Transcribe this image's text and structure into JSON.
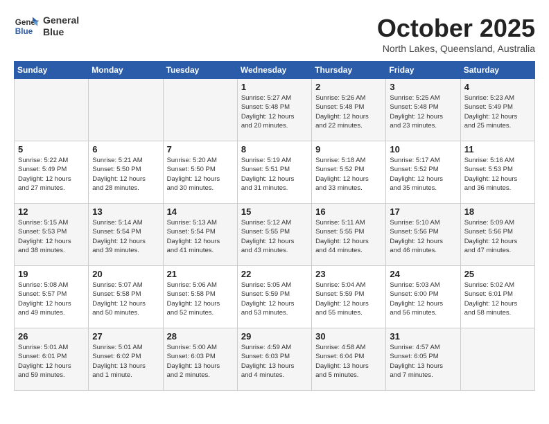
{
  "header": {
    "logo_line1": "General",
    "logo_line2": "Blue",
    "month_year": "October 2025",
    "location": "North Lakes, Queensland, Australia"
  },
  "weekdays": [
    "Sunday",
    "Monday",
    "Tuesday",
    "Wednesday",
    "Thursday",
    "Friday",
    "Saturday"
  ],
  "weeks": [
    [
      {
        "day": "",
        "info": ""
      },
      {
        "day": "",
        "info": ""
      },
      {
        "day": "",
        "info": ""
      },
      {
        "day": "1",
        "info": "Sunrise: 5:27 AM\nSunset: 5:48 PM\nDaylight: 12 hours\nand 20 minutes."
      },
      {
        "day": "2",
        "info": "Sunrise: 5:26 AM\nSunset: 5:48 PM\nDaylight: 12 hours\nand 22 minutes."
      },
      {
        "day": "3",
        "info": "Sunrise: 5:25 AM\nSunset: 5:48 PM\nDaylight: 12 hours\nand 23 minutes."
      },
      {
        "day": "4",
        "info": "Sunrise: 5:23 AM\nSunset: 5:49 PM\nDaylight: 12 hours\nand 25 minutes."
      }
    ],
    [
      {
        "day": "5",
        "info": "Sunrise: 5:22 AM\nSunset: 5:49 PM\nDaylight: 12 hours\nand 27 minutes."
      },
      {
        "day": "6",
        "info": "Sunrise: 5:21 AM\nSunset: 5:50 PM\nDaylight: 12 hours\nand 28 minutes."
      },
      {
        "day": "7",
        "info": "Sunrise: 5:20 AM\nSunset: 5:50 PM\nDaylight: 12 hours\nand 30 minutes."
      },
      {
        "day": "8",
        "info": "Sunrise: 5:19 AM\nSunset: 5:51 PM\nDaylight: 12 hours\nand 31 minutes."
      },
      {
        "day": "9",
        "info": "Sunrise: 5:18 AM\nSunset: 5:52 PM\nDaylight: 12 hours\nand 33 minutes."
      },
      {
        "day": "10",
        "info": "Sunrise: 5:17 AM\nSunset: 5:52 PM\nDaylight: 12 hours\nand 35 minutes."
      },
      {
        "day": "11",
        "info": "Sunrise: 5:16 AM\nSunset: 5:53 PM\nDaylight: 12 hours\nand 36 minutes."
      }
    ],
    [
      {
        "day": "12",
        "info": "Sunrise: 5:15 AM\nSunset: 5:53 PM\nDaylight: 12 hours\nand 38 minutes."
      },
      {
        "day": "13",
        "info": "Sunrise: 5:14 AM\nSunset: 5:54 PM\nDaylight: 12 hours\nand 39 minutes."
      },
      {
        "day": "14",
        "info": "Sunrise: 5:13 AM\nSunset: 5:54 PM\nDaylight: 12 hours\nand 41 minutes."
      },
      {
        "day": "15",
        "info": "Sunrise: 5:12 AM\nSunset: 5:55 PM\nDaylight: 12 hours\nand 43 minutes."
      },
      {
        "day": "16",
        "info": "Sunrise: 5:11 AM\nSunset: 5:55 PM\nDaylight: 12 hours\nand 44 minutes."
      },
      {
        "day": "17",
        "info": "Sunrise: 5:10 AM\nSunset: 5:56 PM\nDaylight: 12 hours\nand 46 minutes."
      },
      {
        "day": "18",
        "info": "Sunrise: 5:09 AM\nSunset: 5:56 PM\nDaylight: 12 hours\nand 47 minutes."
      }
    ],
    [
      {
        "day": "19",
        "info": "Sunrise: 5:08 AM\nSunset: 5:57 PM\nDaylight: 12 hours\nand 49 minutes."
      },
      {
        "day": "20",
        "info": "Sunrise: 5:07 AM\nSunset: 5:58 PM\nDaylight: 12 hours\nand 50 minutes."
      },
      {
        "day": "21",
        "info": "Sunrise: 5:06 AM\nSunset: 5:58 PM\nDaylight: 12 hours\nand 52 minutes."
      },
      {
        "day": "22",
        "info": "Sunrise: 5:05 AM\nSunset: 5:59 PM\nDaylight: 12 hours\nand 53 minutes."
      },
      {
        "day": "23",
        "info": "Sunrise: 5:04 AM\nSunset: 5:59 PM\nDaylight: 12 hours\nand 55 minutes."
      },
      {
        "day": "24",
        "info": "Sunrise: 5:03 AM\nSunset: 6:00 PM\nDaylight: 12 hours\nand 56 minutes."
      },
      {
        "day": "25",
        "info": "Sunrise: 5:02 AM\nSunset: 6:01 PM\nDaylight: 12 hours\nand 58 minutes."
      }
    ],
    [
      {
        "day": "26",
        "info": "Sunrise: 5:01 AM\nSunset: 6:01 PM\nDaylight: 12 hours\nand 59 minutes."
      },
      {
        "day": "27",
        "info": "Sunrise: 5:01 AM\nSunset: 6:02 PM\nDaylight: 13 hours\nand 1 minute."
      },
      {
        "day": "28",
        "info": "Sunrise: 5:00 AM\nSunset: 6:03 PM\nDaylight: 13 hours\nand 2 minutes."
      },
      {
        "day": "29",
        "info": "Sunrise: 4:59 AM\nSunset: 6:03 PM\nDaylight: 13 hours\nand 4 minutes."
      },
      {
        "day": "30",
        "info": "Sunrise: 4:58 AM\nSunset: 6:04 PM\nDaylight: 13 hours\nand 5 minutes."
      },
      {
        "day": "31",
        "info": "Sunrise: 4:57 AM\nSunset: 6:05 PM\nDaylight: 13 hours\nand 7 minutes."
      },
      {
        "day": "",
        "info": ""
      }
    ]
  ]
}
